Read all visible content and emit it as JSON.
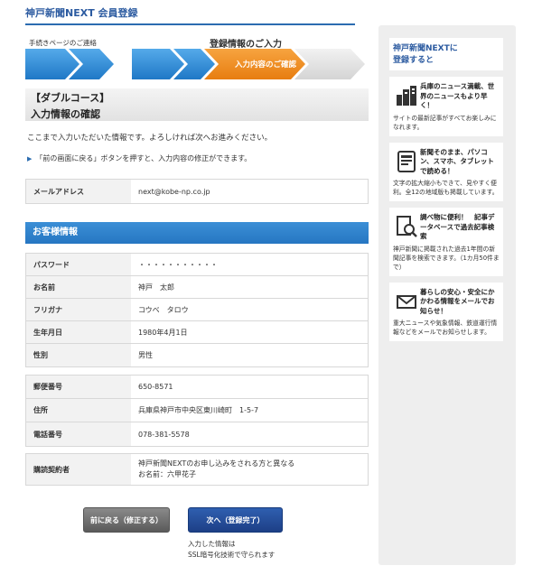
{
  "header": {
    "title": "神戸新聞NEXT  会員登録"
  },
  "steps": {
    "step1_label": "手続きページのご連絡",
    "step2_label": "登録情報のご入力",
    "step3_label": "入力内容のご確認"
  },
  "section": {
    "title_line1": "【ダブルコース】",
    "title_line2": "入力情報の確認"
  },
  "intro": "ここまで入力いただいた情報です。よろしければ次へお進みください。",
  "note": "「前の画面に戻る」ボタンを押すと、入力内容の修正ができます。",
  "email": {
    "label": "メールアドレス",
    "value": "next@kobe-np.co.jp"
  },
  "customer": {
    "heading": "お客様情報",
    "group1": [
      {
        "label": "パスワード",
        "value": "・・・・・・・・・・・"
      },
      {
        "label": "お名前",
        "value": "神戸　太郎"
      },
      {
        "label": "フリガナ",
        "value": "コウベ　タロウ"
      },
      {
        "label": "生年月日",
        "value": "1980年4月1日"
      },
      {
        "label": "性別",
        "value": "男性"
      }
    ],
    "group2": [
      {
        "label": "郵便番号",
        "value": "650-8571"
      },
      {
        "label": "住所",
        "value": "兵庫県神戸市中央区東川崎町　1-5-7"
      },
      {
        "label": "電話番号",
        "value": "078-381-5578"
      }
    ],
    "subscriber": {
      "label": "購読契約者",
      "value_line1": "神戸新聞NEXTのお申し込みをされる方と異なる",
      "value_line2": "お名前：六甲花子"
    }
  },
  "buttons": {
    "back_label": "前に戻る（修正する）",
    "next_label": "次へ（登録完了）"
  },
  "ssl": {
    "line1": "入力した情報は",
    "line2": "SSL暗号化技術で守られます"
  },
  "sidebar": {
    "title_line1": "神戸新聞NEXTに",
    "title_line2": "登録すると",
    "items": [
      {
        "icon": "building-icon",
        "title": "兵庫のニュース満載、世界のニュースもより早く！",
        "desc": "サイトの最新記事がすべてお楽しみになれます。"
      },
      {
        "icon": "tablet-icon",
        "title": "新聞そのまま、パソコン、スマホ、タブレットで読める！",
        "desc": "文字の拡大縮小もできて、見やすく便利。全12の地域版も掲載しています。"
      },
      {
        "icon": "document-search-icon",
        "title": "調べ物に便利！　記事データベースで過去記事検索",
        "desc": "神戸新聞に掲載された過去1年間の新聞記事を検索できます。（1カ月50件まで）"
      },
      {
        "icon": "mail-icon",
        "title": "暮らしの安心・安全にかかわる情報をメールでお知らせ！",
        "desc": "重大ニュースや気象情報、鉄道運行情報などをメールでお知らせします。"
      }
    ]
  },
  "colors": {
    "brand_blue": "#2b5aa0",
    "step_active": "#f08a1c",
    "step_done": "#2b8fd6"
  }
}
